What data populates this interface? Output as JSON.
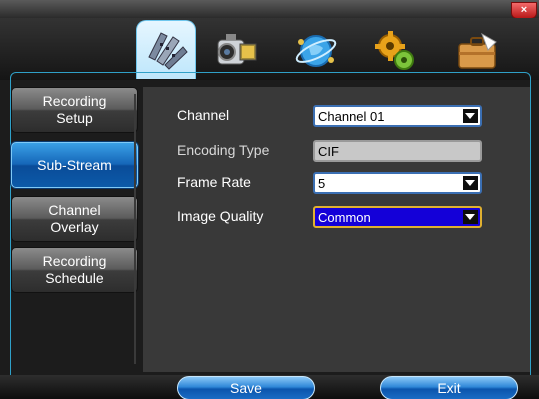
{
  "window": {
    "close_glyph": "×"
  },
  "toolbar": {
    "tabs": [
      {
        "name": "record-settings",
        "icon": "film-icon",
        "active": true
      },
      {
        "name": "camera",
        "icon": "video-camera-icon",
        "active": false
      },
      {
        "name": "network",
        "icon": "network-globe-icon",
        "active": false
      },
      {
        "name": "system",
        "icon": "gears-icon",
        "active": false
      },
      {
        "name": "tools",
        "icon": "briefcase-icon",
        "active": false
      }
    ]
  },
  "sidebar": {
    "items": [
      {
        "line1": "Recording",
        "line2": "Setup",
        "active": false
      },
      {
        "line1": "Sub-Stream",
        "line2": "",
        "active": true
      },
      {
        "line1": "Channel",
        "line2": "Overlay",
        "active": false
      },
      {
        "line1": "Recording",
        "line2": "Schedule",
        "active": false
      }
    ]
  },
  "form": {
    "channel": {
      "label": "Channel",
      "value": "Channel 01"
    },
    "encoding_type": {
      "label": "Encoding Type",
      "value": "CIF"
    },
    "frame_rate": {
      "label": "Frame Rate",
      "value": "5"
    },
    "image_quality": {
      "label": "Image Quality",
      "value": "Common"
    }
  },
  "footer": {
    "save_label": "Save",
    "exit_label": "Exit"
  },
  "colors": {
    "accent": "#1566b8",
    "selected_field": "#1400d8",
    "close": "#d02a2a"
  }
}
